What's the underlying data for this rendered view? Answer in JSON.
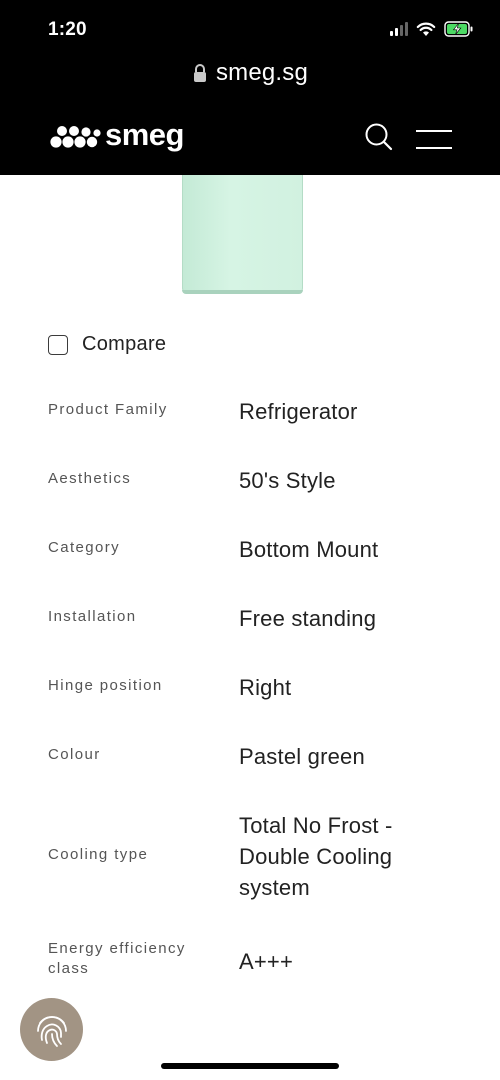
{
  "status_bar": {
    "time": "1:20"
  },
  "browser": {
    "url": "smeg.sg"
  },
  "header": {
    "brand": "smeg"
  },
  "compare": {
    "label": "Compare",
    "checked": false
  },
  "specs": [
    {
      "label": "Product Family",
      "value": "Refrigerator"
    },
    {
      "label": "Aesthetics",
      "value": "50's Style"
    },
    {
      "label": "Category",
      "value": "Bottom Mount"
    },
    {
      "label": "Installation",
      "value": "Free standing"
    },
    {
      "label": "Hinge position",
      "value": "Right"
    },
    {
      "label": "Colour",
      "value": "Pastel green"
    },
    {
      "label": "Cooling type",
      "value": "Total No Frost - Double Cooling system"
    },
    {
      "label": "Energy efficiency class",
      "value": "A+++"
    }
  ],
  "colors": {
    "header_bg": "#000000",
    "product_green": "#d1f1e0",
    "fab_bg": "#a29484",
    "battery_green": "#4cd964"
  }
}
